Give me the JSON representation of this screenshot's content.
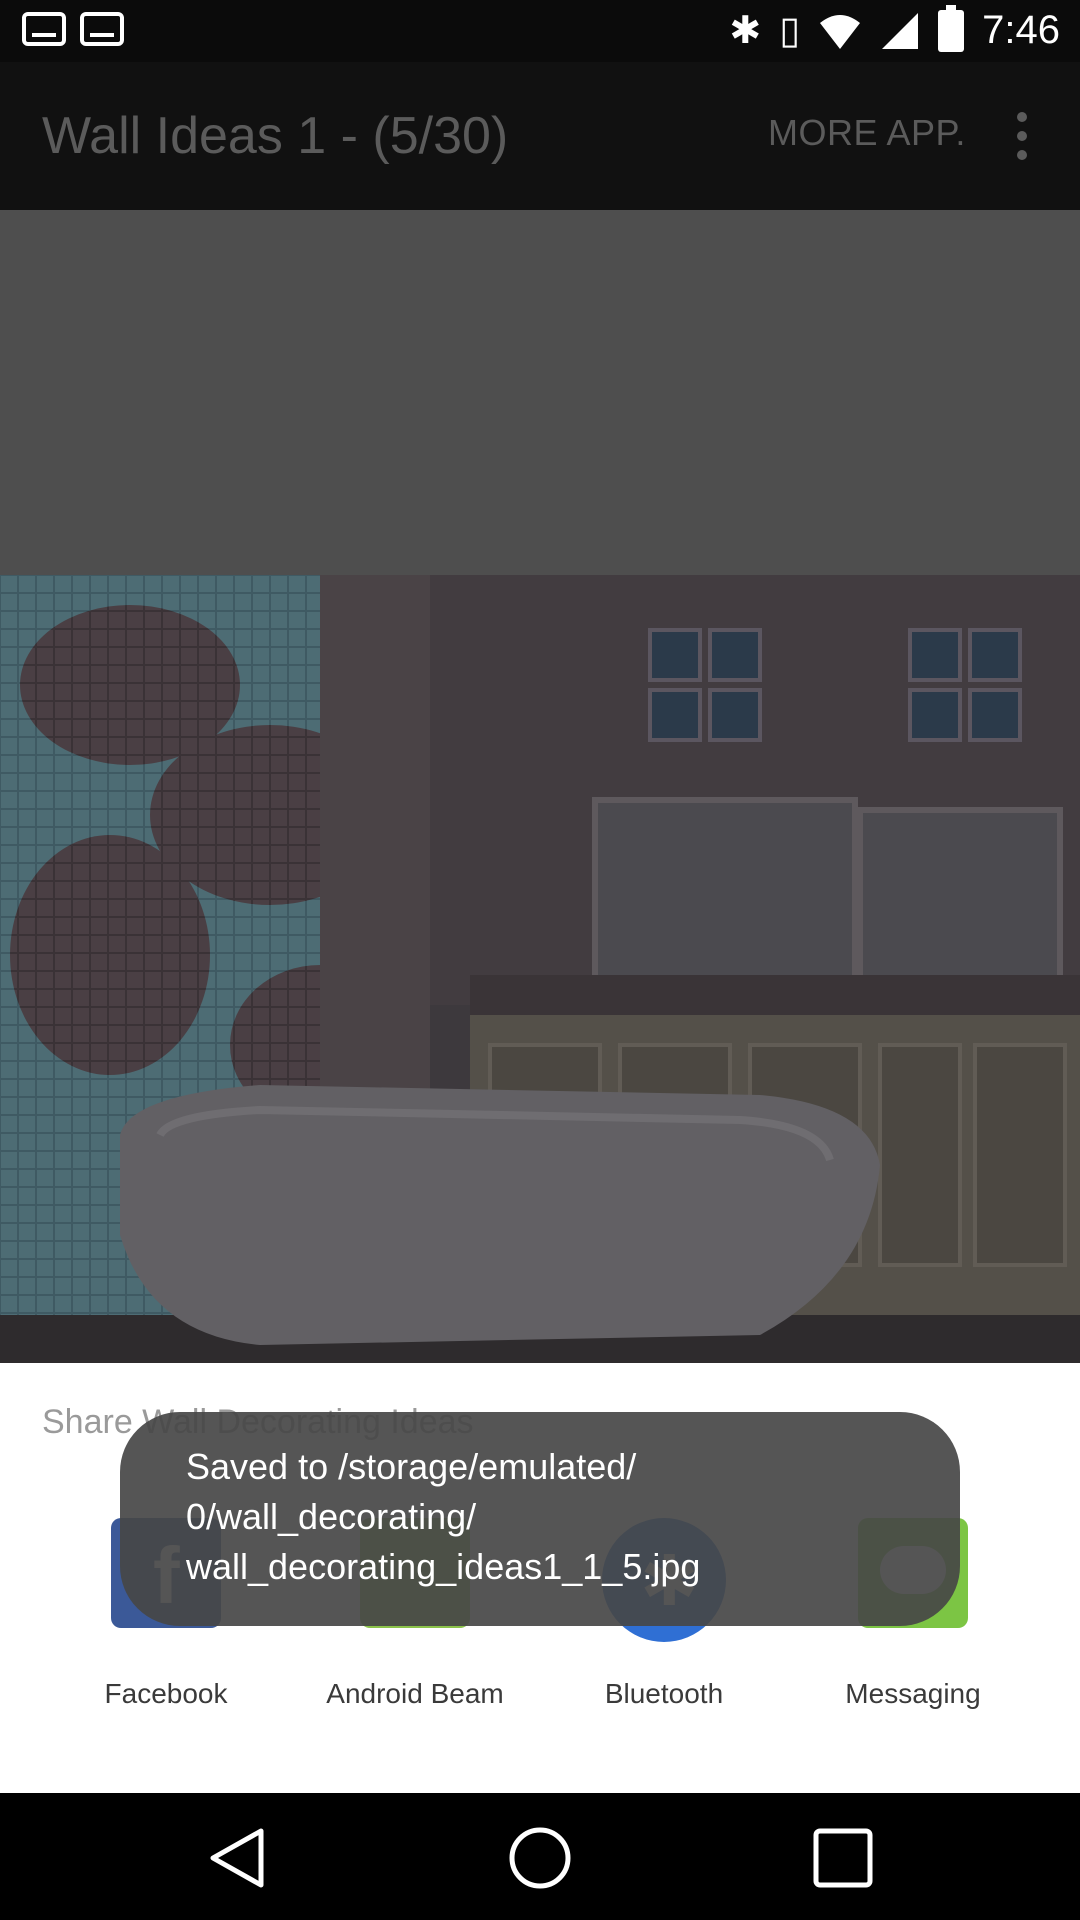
{
  "status_bar": {
    "time": "7:46",
    "icons": [
      "notification-icon",
      "notification-icon",
      "bluetooth-icon",
      "vibrate-icon",
      "wifi-icon",
      "signal-icon",
      "battery-icon"
    ]
  },
  "app_bar": {
    "title": "Wall Ideas 1 - (5/30)",
    "more_app_label": "MORE APP.",
    "overflow_icon": "overflow-menu-icon"
  },
  "share_sheet": {
    "title": "Share Wall Decorating Ideas",
    "apps": [
      {
        "label": "Facebook",
        "icon": "facebook-icon",
        "color": "#3b5998"
      },
      {
        "label": "Android Beam",
        "icon": "android-beam-icon",
        "color": "#8bc34a"
      },
      {
        "label": "Bluetooth",
        "icon": "bluetooth-icon",
        "color": "#2f6fd4"
      },
      {
        "label": "Messaging",
        "icon": "messaging-icon",
        "color": "#7cc544"
      }
    ]
  },
  "toast": {
    "line1": "Saved to /storage/emulated/",
    "line2": "0/wall_decorating/",
    "line3": "wall_decorating_ideas1_1_5.jpg"
  },
  "nav_bar": {
    "icons": [
      "back-icon",
      "home-icon",
      "recents-icon"
    ]
  }
}
